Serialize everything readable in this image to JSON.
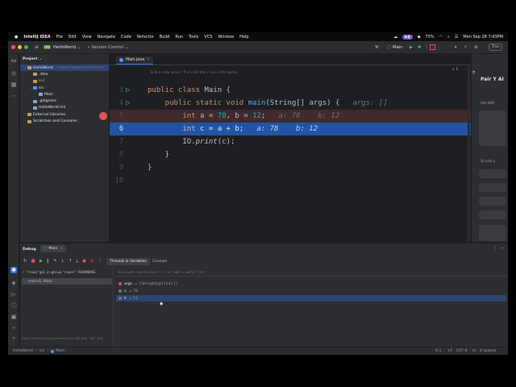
{
  "menubar": {
    "app_name": "IntelliJ IDEA",
    "items": [
      "File",
      "Edit",
      "View",
      "Navigate",
      "Code",
      "Refactor",
      "Build",
      "Run",
      "Tools",
      "VCS",
      "Window",
      "Help"
    ],
    "battery": "75%",
    "clock": "Mon Sep 28  7:43PM"
  },
  "toolbar": {
    "project_badge": "HW",
    "project_name": "HelloWorld",
    "vcs_label": "Version Control",
    "run_config": "Main",
    "trial_label": "Trial"
  },
  "project_panel": {
    "title": "Project",
    "tree": [
      {
        "label": "HelloWorld",
        "hint": "~/IdeaProjects/HelloWorld",
        "icon": "folder",
        "indent": 0
      },
      {
        "label": ".idea",
        "hint": "",
        "icon": "folder",
        "indent": 1
      },
      {
        "label": "out",
        "hint": "",
        "icon": "folder-orange",
        "indent": 1
      },
      {
        "label": "src",
        "hint": "",
        "icon": "folder-blue",
        "indent": 1
      },
      {
        "label": "Main",
        "hint": "",
        "icon": "class",
        "indent": 2
      },
      {
        "label": ".gitignore",
        "hint": "",
        "icon": "file",
        "indent": 1
      },
      {
        "label": "HelloWorld.iml",
        "hint": "",
        "icon": "file",
        "indent": 1
      },
      {
        "label": "External Libraries",
        "hint": "",
        "icon": "lib",
        "indent": 0
      },
      {
        "label": "Scratches and Consoles",
        "hint": "",
        "icon": "scratch",
        "indent": 0
      }
    ]
  },
  "editor": {
    "tab_label": "Main.java",
    "hint_text": "To Run code, press  ⌃R  or click the  ▷  icon in the gutter.",
    "warning_count": "1",
    "lines": [
      {
        "num": "3",
        "text_parts": [
          [
            "kw",
            "public class "
          ],
          [
            "",
            "Main {"
          ]
        ],
        "inline": ""
      },
      {
        "num": "4",
        "text_parts": [
          [
            "kw",
            "    public static void "
          ],
          [
            "fn",
            "main"
          ],
          [
            "",
            "(String[] args) {"
          ]
        ],
        "inline": "args: []"
      },
      {
        "num": "5",
        "text_parts": [
          [
            "kw",
            "        int "
          ],
          [
            "",
            "a = "
          ],
          [
            "num",
            "78"
          ],
          [
            "",
            ", b = "
          ],
          [
            "num",
            "12"
          ],
          [
            "",
            ";"
          ]
        ],
        "inline": "a: 78    b: 12"
      },
      {
        "num": "6",
        "text_parts": [
          [
            "kw",
            "        int "
          ],
          [
            "",
            "c = a + b;"
          ]
        ],
        "inline": "a: 78    b: 12"
      },
      {
        "num": "7",
        "text_parts": [
          [
            "",
            "        IO."
          ],
          [
            "it",
            "print"
          ],
          [
            "",
            "(c);"
          ]
        ],
        "inline": ""
      },
      {
        "num": "8",
        "text_parts": [
          [
            "",
            "    }"
          ]
        ],
        "inline": ""
      },
      {
        "num": "9",
        "text_parts": [
          [
            "",
            "}"
          ]
        ],
        "inline": ""
      },
      {
        "num": "10",
        "text_parts": [
          [
            "",
            ""
          ]
        ],
        "inline": ""
      }
    ]
  },
  "right_panel": {
    "title": "Pair Y AI",
    "sub": "Use JetB",
    "or_pick": "Or pick y"
  },
  "debug": {
    "title": "Debug",
    "session_tab": "Main",
    "threads_tab": "Threads & Variables",
    "console_tab": "Console",
    "thread_status": "\"main\"@1 in group \"main\": RUNNING",
    "frame": "main:6, Main",
    "expression_placeholder": "Evaluate expression (⏎) or add a watch (⌘⏎)",
    "variables": [
      {
        "name": "args",
        "value": "= {String[0]@1114} []",
        "icon_color": "#c75450"
      },
      {
        "name": "a",
        "value": "= 78",
        "icon_color": "#6f737a"
      },
      {
        "name": "b",
        "value": "= 12",
        "icon_color": "#6f737a"
      }
    ],
    "frames_hint": "Switch frames from anywhere in the IDE with ⌃⌘↑ and ..."
  },
  "statusbar": {
    "crumbs": [
      "HelloWorld",
      "src",
      "Main"
    ],
    "position": "6:1",
    "line_sep": "LF",
    "encoding": "UTF-8",
    "indent": "4 spaces"
  }
}
